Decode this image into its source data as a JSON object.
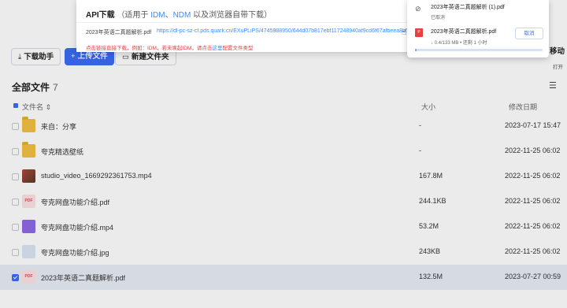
{
  "toolbar": {
    "download_helper": "下载助手",
    "upload": "上传文件",
    "new_folder": "新建文件夹",
    "move": "移动",
    "open_label": "打开"
  },
  "list": {
    "title": "全部文件",
    "count": "7",
    "col_name": "文件名",
    "col_size": "大小",
    "col_date": "修改日期"
  },
  "files": [
    {
      "name": "来自：分享",
      "size": "-",
      "date": "2023-07-17 15:47",
      "type": "folder",
      "selected": false
    },
    {
      "name": "夸克精选壁纸",
      "size": "-",
      "date": "2022-11-25 06:02",
      "type": "folder",
      "selected": false
    },
    {
      "name": "studio_video_1669292361753.mp4",
      "size": "167.8M",
      "date": "2022-11-25 06:02",
      "type": "video",
      "selected": false
    },
    {
      "name": "夸克网盘功能介绍.pdf",
      "size": "244.1KB",
      "date": "2022-11-25 06:02",
      "type": "pdf",
      "selected": false
    },
    {
      "name": "夸克网盘功能介绍.mp4",
      "size": "53.2M",
      "date": "2022-11-25 06:02",
      "type": "mp4",
      "selected": false
    },
    {
      "name": "夸克网盘功能介绍.jpg",
      "size": "243KB",
      "date": "2022-11-25 06:02",
      "type": "jpg",
      "selected": false
    },
    {
      "name": "2023年英语二真题解析.pdf",
      "size": "132.5M",
      "date": "2023-07-27 00:59",
      "type": "pdf",
      "selected": true
    }
  ],
  "api": {
    "title": "API下载",
    "note_prefix": "（适用于",
    "idm": "IDM",
    "sep": "、",
    "ndm": "NDM",
    "note_suffix": "以及浏览器自带下载）",
    "file_name": "2023年英语二真题解析.pdf",
    "link": "https://dl-pc-sz-cf.pds.quark.cn/EXuPLiPS/4745988950/644d07b817ebf117248940af9cd6f67afbeea8b5/64",
    "warn_prefix": "点击链接直接下载，例如：IDM，若未唤起IDM，请点击",
    "warn_link": "这里",
    "warn_suffix": "配置文件类型"
  },
  "downloads": {
    "item1_name": "2023年英语二真题解析 (1).pdf",
    "item1_status": "已取消",
    "item2_name": "2023年英语二真题解析.pdf",
    "item2_status": "↓ 0.4/133 MB • 还剩 1 小时",
    "cancel_label": "取消",
    "progress": 0.003
  }
}
